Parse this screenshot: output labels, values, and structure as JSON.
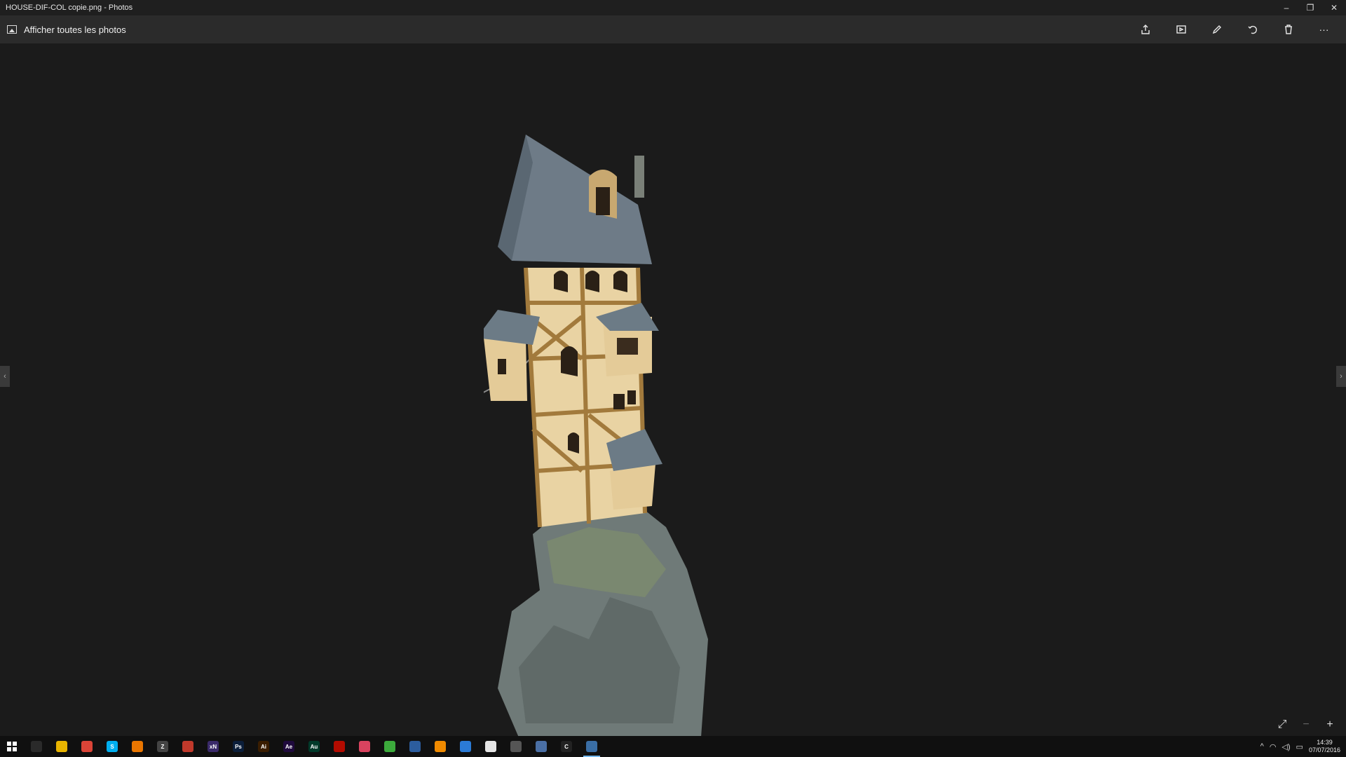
{
  "window": {
    "title": "HOUSE-DIF-COL copie.png - Photos",
    "controls": {
      "minimize": "–",
      "restore": "❐",
      "close": "✕"
    }
  },
  "appbar": {
    "back_label": "Afficher toutes les photos",
    "tools": [
      "share-icon",
      "slideshow-icon",
      "edit-icon",
      "rotate-icon",
      "delete-icon",
      "more-icon"
    ],
    "more_glyph": "···"
  },
  "viewer": {
    "nav_prev": "‹",
    "nav_next": "›",
    "zoom": {
      "fit": "⤢",
      "out": "−",
      "in": "+"
    }
  },
  "taskbar": {
    "apps": [
      {
        "name": "task-view",
        "label": "",
        "color": "#2a2a2a"
      },
      {
        "name": "file-explorer",
        "label": "",
        "color": "#e8b400"
      },
      {
        "name": "chrome",
        "label": "",
        "color": "#db4437"
      },
      {
        "name": "skype",
        "label": "S",
        "color": "#00aff0"
      },
      {
        "name": "blender",
        "label": "",
        "color": "#ea7600"
      },
      {
        "name": "zbrush",
        "label": "Z",
        "color": "#444444"
      },
      {
        "name": "app-red",
        "label": "",
        "color": "#c0392b"
      },
      {
        "name": "xnview",
        "label": "xN",
        "color": "#3a2a6a"
      },
      {
        "name": "photoshop",
        "label": "Ps",
        "color": "#0b1e3a"
      },
      {
        "name": "illustrator",
        "label": "Ai",
        "color": "#3a1d00"
      },
      {
        "name": "after-effects",
        "label": "Ae",
        "color": "#1f0a3d"
      },
      {
        "name": "audition",
        "label": "Au",
        "color": "#003a2a"
      },
      {
        "name": "acrobat",
        "label": "",
        "color": "#b30b00"
      },
      {
        "name": "app-pink",
        "label": "",
        "color": "#d9435f"
      },
      {
        "name": "camtasia",
        "label": "",
        "color": "#3caa3c"
      },
      {
        "name": "app-blue",
        "label": "",
        "color": "#2c5d9e"
      },
      {
        "name": "vlc",
        "label": "",
        "color": "#f08a00"
      },
      {
        "name": "app-globe",
        "label": "",
        "color": "#2b7bd6"
      },
      {
        "name": "itunes",
        "label": "",
        "color": "#e5e5e5"
      },
      {
        "name": "app-circle",
        "label": "",
        "color": "#555555"
      },
      {
        "name": "app-window",
        "label": "",
        "color": "#4a6fa5"
      },
      {
        "name": "app-c",
        "label": "C",
        "color": "#222222"
      },
      {
        "name": "photos",
        "label": "",
        "color": "#3a6ea5",
        "active": true
      }
    ],
    "clock": {
      "time": "14:39",
      "date": "07/07/2016"
    }
  }
}
